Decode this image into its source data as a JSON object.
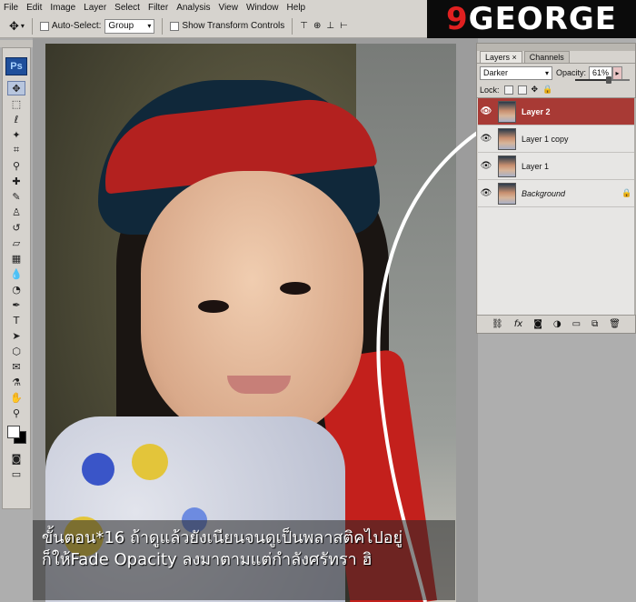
{
  "menu": {
    "items": [
      "File",
      "Edit",
      "Image",
      "Layer",
      "Select",
      "Filter",
      "Analysis",
      "View",
      "Window",
      "Help"
    ]
  },
  "brand": {
    "number": "9",
    "text": "GEORGE"
  },
  "options_bar": {
    "auto_select_label": "Auto-Select:",
    "auto_select_value": "Group",
    "show_transform_label": "Show Transform Controls"
  },
  "toolbox": {
    "logo": "Ps",
    "tools": [
      "move-icon",
      "marquee-icon",
      "lasso-icon",
      "magic-wand-icon",
      "crop-icon",
      "eyedropper-icon",
      "healing-brush-icon",
      "brush-icon",
      "clone-stamp-icon",
      "history-brush-icon",
      "eraser-icon",
      "gradient-icon",
      "blur-icon",
      "dodge-icon",
      "pen-icon",
      "type-icon",
      "path-select-icon",
      "shape-icon",
      "notes-icon",
      "eyedropper2-icon",
      "hand-icon",
      "zoom-icon"
    ]
  },
  "layers_panel": {
    "tabs": [
      "Layers",
      "Channels"
    ],
    "blend_mode": "Darker",
    "opacity_label": "Opacity:",
    "opacity_value": "61%",
    "opacity_fraction": 0.61,
    "lock_label": "Lock:",
    "layers": [
      {
        "name": "Layer 2",
        "selected": true,
        "locked": false,
        "italic": false
      },
      {
        "name": "Layer 1 copy",
        "selected": false,
        "locked": false,
        "italic": false
      },
      {
        "name": "Layer 1",
        "selected": false,
        "locked": false,
        "italic": false
      },
      {
        "name": "Background",
        "selected": false,
        "locked": true,
        "italic": true
      }
    ]
  },
  "caption": {
    "line1": "ขั้นตอน*16 ถ้าดูแล้วยังเนียนจนดูเป็นพลาสติคไปอยู่",
    "line2": "ก็ให้Fade Opacity ลงมาตามแต่กำลังศรัทรา ฮิ"
  },
  "colors": {
    "selected_layer": "#a83a35",
    "panel_bg": "#d6d3ce",
    "brand_red": "#e02020"
  }
}
